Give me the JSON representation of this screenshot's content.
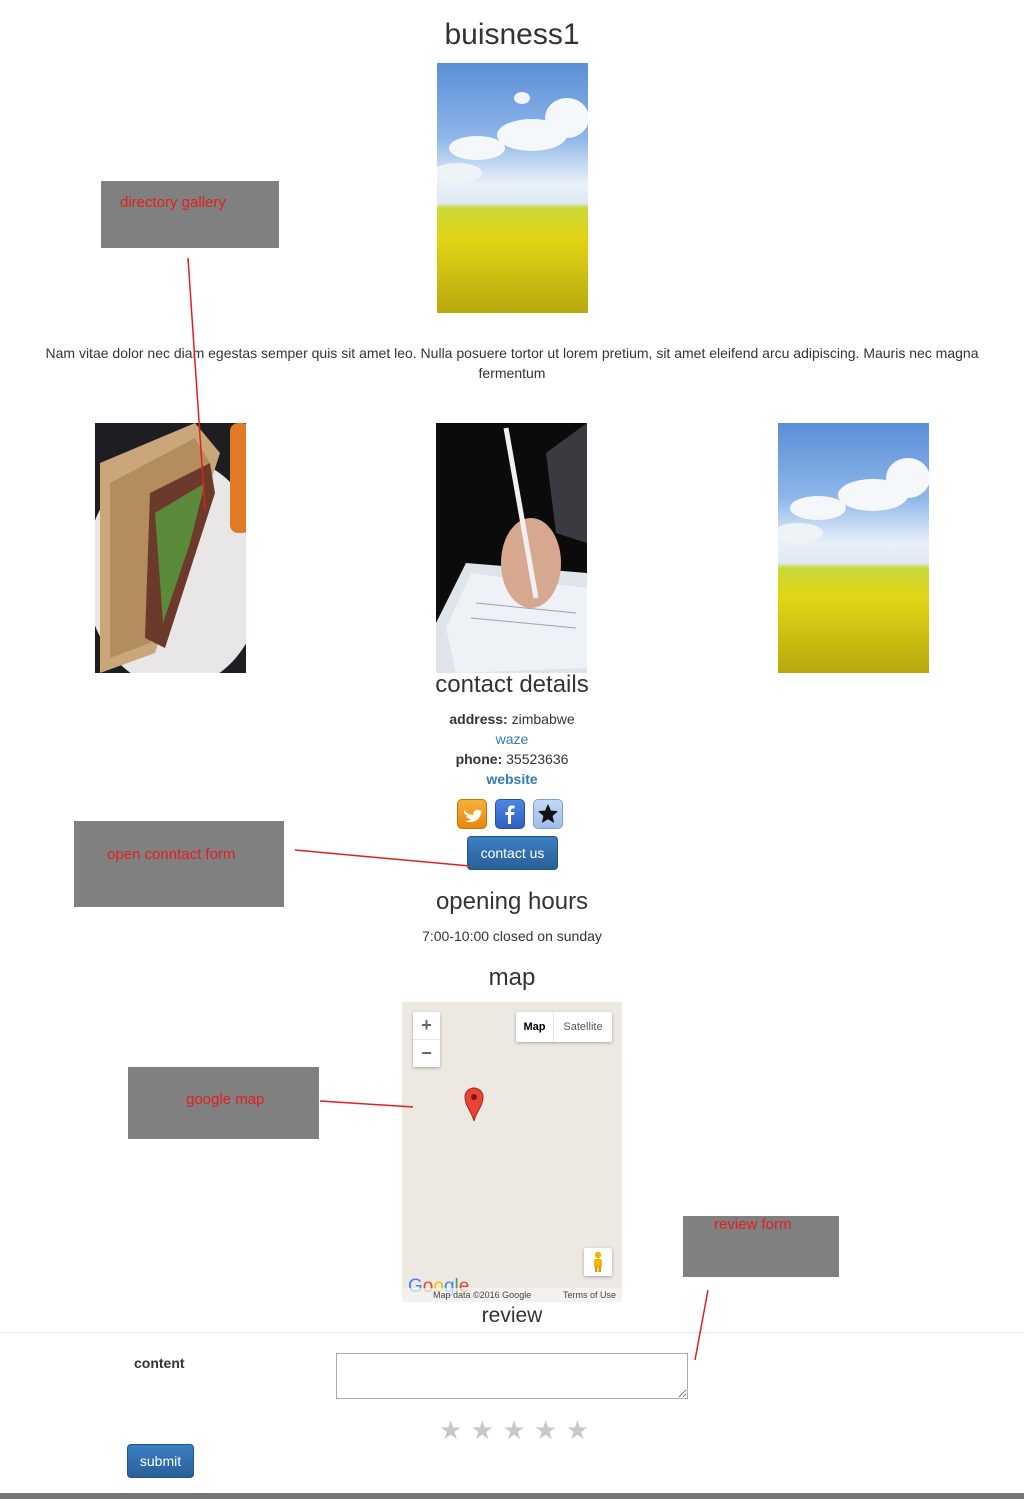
{
  "page": {
    "title": "buisness1",
    "description": "Nam vitae dolor nec diam egestas semper quis sit amet leo. Nulla posuere tortor ut lorem pretium, sit amet eleifend arcu adipiscing. Mauris nec magna fermentum"
  },
  "contact": {
    "heading": "contact details",
    "address_label": "address:",
    "address_value": "zimbabwe",
    "waze_link": "waze",
    "phone_label": "phone:",
    "phone_value": "35523636",
    "website_link": "website",
    "contact_button": "contact us",
    "social_icons": [
      "twitter-icon",
      "facebook-icon",
      "star-icon"
    ]
  },
  "hours": {
    "heading": "opening hours",
    "text": "7:00-10:00 closed on sunday"
  },
  "map": {
    "heading": "map",
    "zoom_in": "+",
    "zoom_out": "−",
    "type_map": "Map",
    "type_satellite": "Satellite",
    "attribution": "Map data ©2016 Google",
    "terms": "Terms of Use",
    "logo": "Google"
  },
  "review": {
    "heading": "review",
    "content_label": "content",
    "content_value": "",
    "rating": 0,
    "max_rating": 5,
    "submit": "submit"
  },
  "annotations": {
    "gallery": "directory gallery",
    "contact_form": "open conntact form",
    "google_map": "google map",
    "review_form": "review form"
  },
  "colors": {
    "annotation_bg": "#808080",
    "annotation_text": "#e41e1e",
    "link": "#337ab7",
    "primary_button": "#2f6ea9",
    "social_orange": "#f39c12",
    "social_blue": "#3b6fd0",
    "social_light": "#a9c6ef"
  }
}
